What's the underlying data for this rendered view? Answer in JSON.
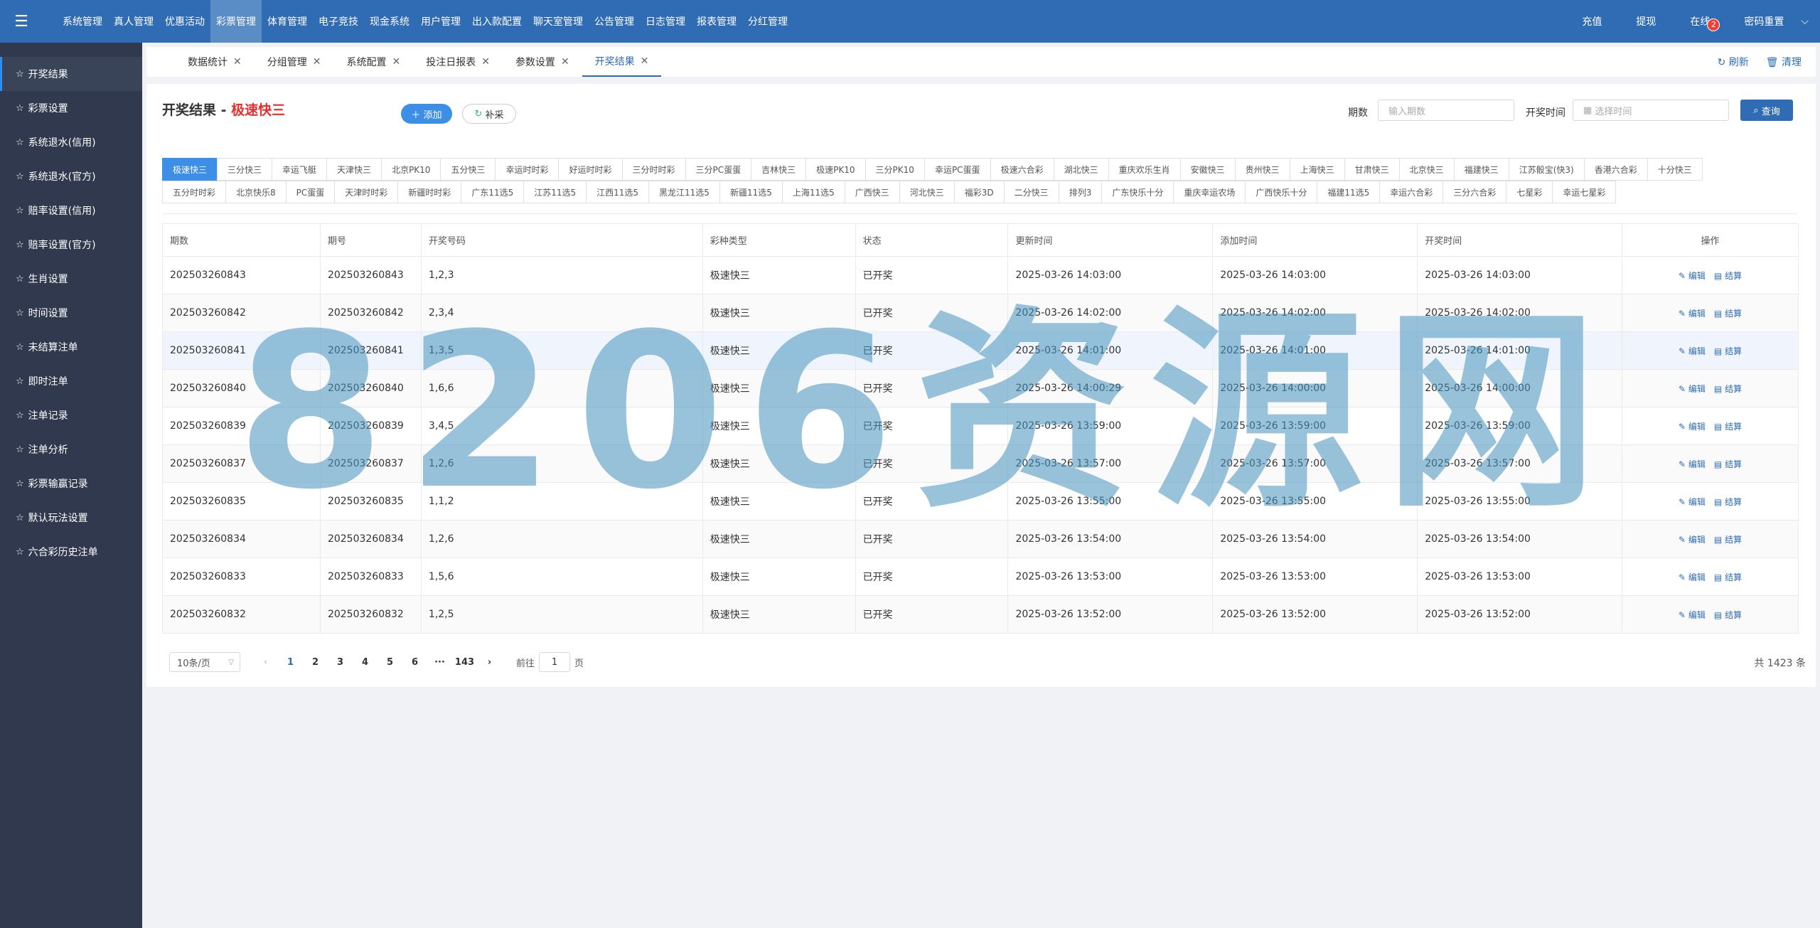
{
  "topnav": {
    "menu_icon": "hamburger-menu-icon",
    "items": [
      "系统管理",
      "真人管理",
      "优惠活动",
      "彩票管理",
      "体育管理",
      "电子竞技",
      "现金系统",
      "用户管理",
      "出入款配置",
      "聊天室管理",
      "公告管理",
      "日志管理",
      "报表管理",
      "分红管理"
    ],
    "right": {
      "recharge": "充值",
      "withdraw": "提现",
      "online": "在线",
      "online_badge": "2",
      "reset_pwd": "密码重置",
      "chevron": "⌵"
    }
  },
  "sidebar": {
    "items": [
      "开奖结果",
      "彩票设置",
      "系统退水(信用)",
      "系统退水(官方)",
      "赔率设置(信用)",
      "赔率设置(官方)",
      "生肖设置",
      "时间设置",
      "未结算注单",
      "即时注单",
      "注单记录",
      "注单分析",
      "彩票输赢记录",
      "默认玩法设置",
      "六合彩历史注单"
    ]
  },
  "tabs": {
    "items": [
      "数据统计",
      "分组管理",
      "系统配置",
      "投注日报表",
      "参数设置",
      "开奖结果"
    ],
    "close": "✕",
    "refresh": "刷新",
    "clear": "清理"
  },
  "page": {
    "title": "开奖结果",
    "title_sep": " - ",
    "title_highlight": "极速快三",
    "add_label": "添加",
    "buc_label": "补采",
    "filter_issue_label": "期数",
    "filter_issue_placeholder": "输入期数",
    "filter_time_label": "开奖时间",
    "filter_time_placeholder": "选择时间",
    "query_label": "查询"
  },
  "chips": {
    "row1": [
      "极速快三",
      "三分快三",
      "幸运飞艇",
      "天津快三",
      "北京PK10",
      "五分快三",
      "幸运时时彩",
      "好运时时彩",
      "三分时时彩",
      "三分PC蛋蛋",
      "吉林快三",
      "极速PK10",
      "三分PK10",
      "幸运PC蛋蛋",
      "极速六合彩",
      "湖北快三",
      "重庆欢乐生肖",
      "安徽快三",
      "贵州快三",
      "上海快三",
      "甘肃快三",
      "北京快三",
      "福建快三",
      "江苏骰宝(快3)",
      "香港六合彩",
      "十分快三"
    ],
    "row2": [
      "五分时时彩",
      "北京快乐8",
      "PC蛋蛋",
      "天津时时彩",
      "新疆时时彩",
      "广东11选5",
      "江苏11选5",
      "江西11选5",
      "黑龙江11选5",
      "新疆11选5",
      "上海11选5",
      "广西快三",
      "河北快三",
      "福彩3D",
      "二分快三",
      "排列3",
      "广东快乐十分",
      "重庆幸运农场",
      "广西快乐十分",
      "福建11选5",
      "幸运六合彩",
      "三分六合彩",
      "七星彩",
      "幸运七星彩"
    ]
  },
  "table": {
    "headers": [
      "期数",
      "期号",
      "开奖号码",
      "彩种类型",
      "状态",
      "更新时间",
      "添加时间",
      "开奖时间",
      "操作"
    ],
    "rows": [
      [
        "202503260843",
        "202503260843",
        "1,2,3",
        "极速快三",
        "已开奖",
        "2025-03-26 14:03:00",
        "2025-03-26 14:03:00",
        "2025-03-26 14:03:00"
      ],
      [
        "202503260842",
        "202503260842",
        "2,3,4",
        "极速快三",
        "已开奖",
        "2025-03-26 14:02:00",
        "2025-03-26 14:02:00",
        "2025-03-26 14:02:00"
      ],
      [
        "202503260841",
        "202503260841",
        "1,3,5",
        "极速快三",
        "已开奖",
        "2025-03-26 14:01:00",
        "2025-03-26 14:01:00",
        "2025-03-26 14:01:00"
      ],
      [
        "202503260840",
        "202503260840",
        "1,6,6",
        "极速快三",
        "已开奖",
        "2025-03-26 14:00:29",
        "2025-03-26 14:00:00",
        "2025-03-26 14:00:00"
      ],
      [
        "202503260839",
        "202503260839",
        "3,4,5",
        "极速快三",
        "已开奖",
        "2025-03-26 13:59:00",
        "2025-03-26 13:59:00",
        "2025-03-26 13:59:00"
      ],
      [
        "202503260837",
        "202503260837",
        "1,2,6",
        "极速快三",
        "已开奖",
        "2025-03-26 13:57:00",
        "2025-03-26 13:57:00",
        "2025-03-26 13:57:00"
      ],
      [
        "202503260835",
        "202503260835",
        "1,1,2",
        "极速快三",
        "已开奖",
        "2025-03-26 13:55:00",
        "2025-03-26 13:55:00",
        "2025-03-26 13:55:00"
      ],
      [
        "202503260834",
        "202503260834",
        "1,2,6",
        "极速快三",
        "已开奖",
        "2025-03-26 13:54:00",
        "2025-03-26 13:54:00",
        "2025-03-26 13:54:00"
      ],
      [
        "202503260833",
        "202503260833",
        "1,5,6",
        "极速快三",
        "已开奖",
        "2025-03-26 13:53:00",
        "2025-03-26 13:53:00",
        "2025-03-26 13:53:00"
      ],
      [
        "202503260832",
        "202503260832",
        "1,2,5",
        "极速快三",
        "已开奖",
        "2025-03-26 13:52:00",
        "2025-03-26 13:52:00",
        "2025-03-26 13:52:00"
      ]
    ],
    "op_edit": "编辑",
    "op_settle": "结算"
  },
  "pager": {
    "page_size": "10条/页",
    "pages": [
      "1",
      "2",
      "3",
      "4",
      "5",
      "6",
      "···",
      "143"
    ],
    "prev": "‹",
    "next": "›",
    "goto_prefix": "前往",
    "goto_value": "1",
    "goto_suffix": "页",
    "total": "共 1423 条"
  },
  "watermark": "8206资源网"
}
